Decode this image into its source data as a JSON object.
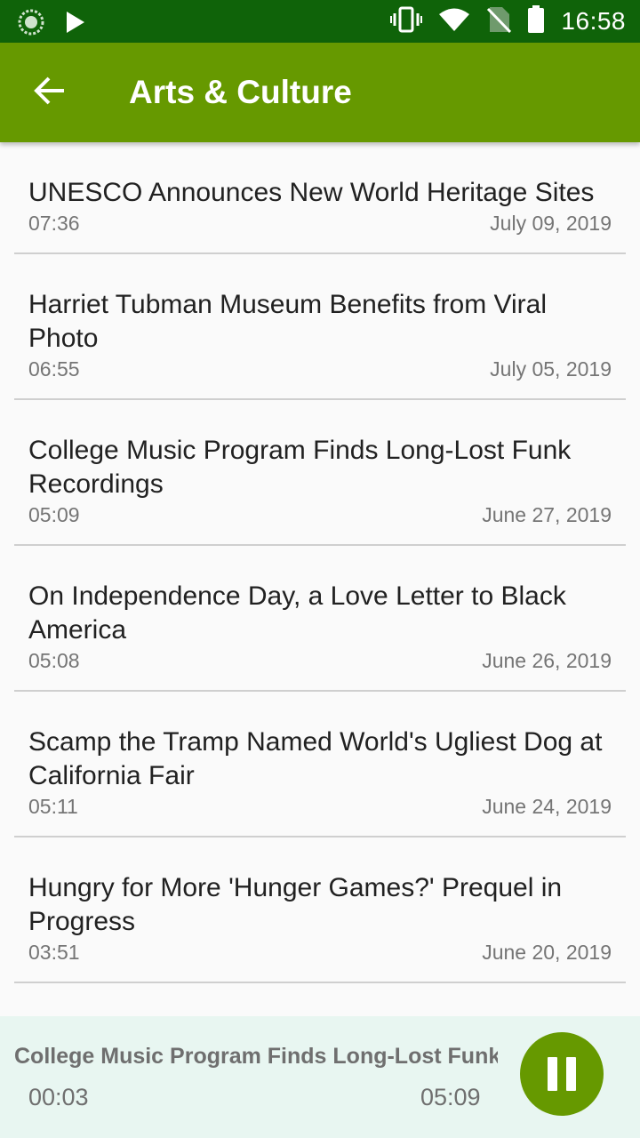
{
  "status_bar": {
    "time": "16:58",
    "icons": [
      "sync-icon",
      "play-store-icon",
      "vibrate-icon",
      "wifi-icon",
      "no-sim-icon",
      "battery-icon"
    ]
  },
  "app_bar": {
    "title": "Arts & Culture",
    "back_icon": "arrow-back-icon"
  },
  "articles": [
    {
      "title": "UNESCO Announces New World Heritage Sites",
      "duration": "07:36",
      "date": "July 09, 2019"
    },
    {
      "title": "Harriet Tubman Museum Benefits from Viral Photo",
      "duration": "06:55",
      "date": "July 05, 2019"
    },
    {
      "title": "College Music Program Finds Long-Lost Funk Recordings",
      "duration": "05:09",
      "date": "June 27, 2019"
    },
    {
      "title": "On Independence Day, a Love Letter to Black America",
      "duration": "05:08",
      "date": "June 26, 2019"
    },
    {
      "title": "Scamp the Tramp Named World's Ugliest Dog at California Fair",
      "duration": "05:11",
      "date": "June 24, 2019"
    },
    {
      "title": "Hungry for More 'Hunger Games?' Prequel in Progress",
      "duration": "03:51",
      "date": "June 20, 2019"
    }
  ],
  "player": {
    "title": "College Music Program Finds Long-Lost Funk Recordings",
    "elapsed": "00:03",
    "duration": "05:09",
    "control_icon": "pause-icon"
  },
  "colors": {
    "status_bar": "#0f6309",
    "app_bar": "#669900",
    "player_bg": "#e8f6f1",
    "accent": "#669900"
  }
}
